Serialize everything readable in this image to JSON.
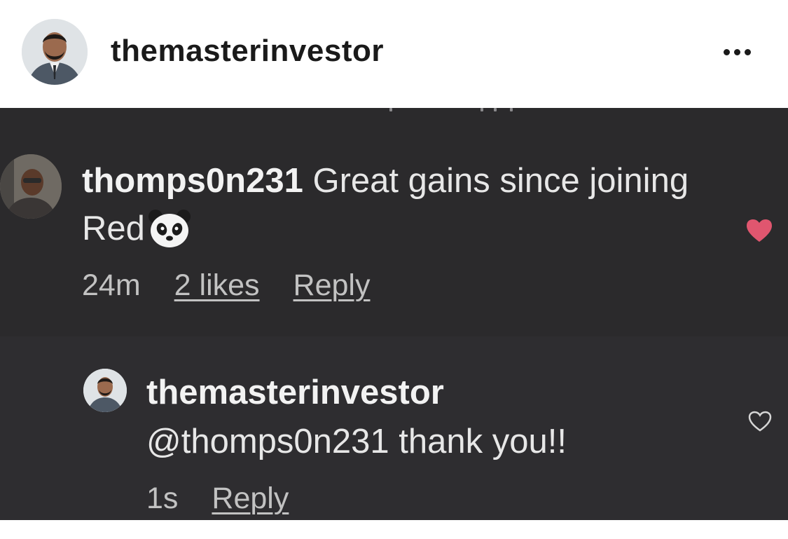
{
  "header": {
    "username": "themasterinvestor"
  },
  "comment": {
    "username": "thomps0n231",
    "text": " Great gains since joining Red",
    "time": "24m",
    "likes": "2 likes",
    "reply_label": "Reply",
    "liked": true
  },
  "reply": {
    "username": "themasterinvestor",
    "text": "@thomps0n231 thank you!!",
    "time": "1s",
    "reply_label": "Reply",
    "liked": false
  },
  "colors": {
    "heart_active": "#e0566f",
    "dark_background": "#2b2a2c",
    "reply_background": "#2e2d30"
  },
  "icons": [
    "more-options-icon",
    "heart-filled-icon",
    "heart-outline-icon",
    "panda-emoji-icon"
  ]
}
